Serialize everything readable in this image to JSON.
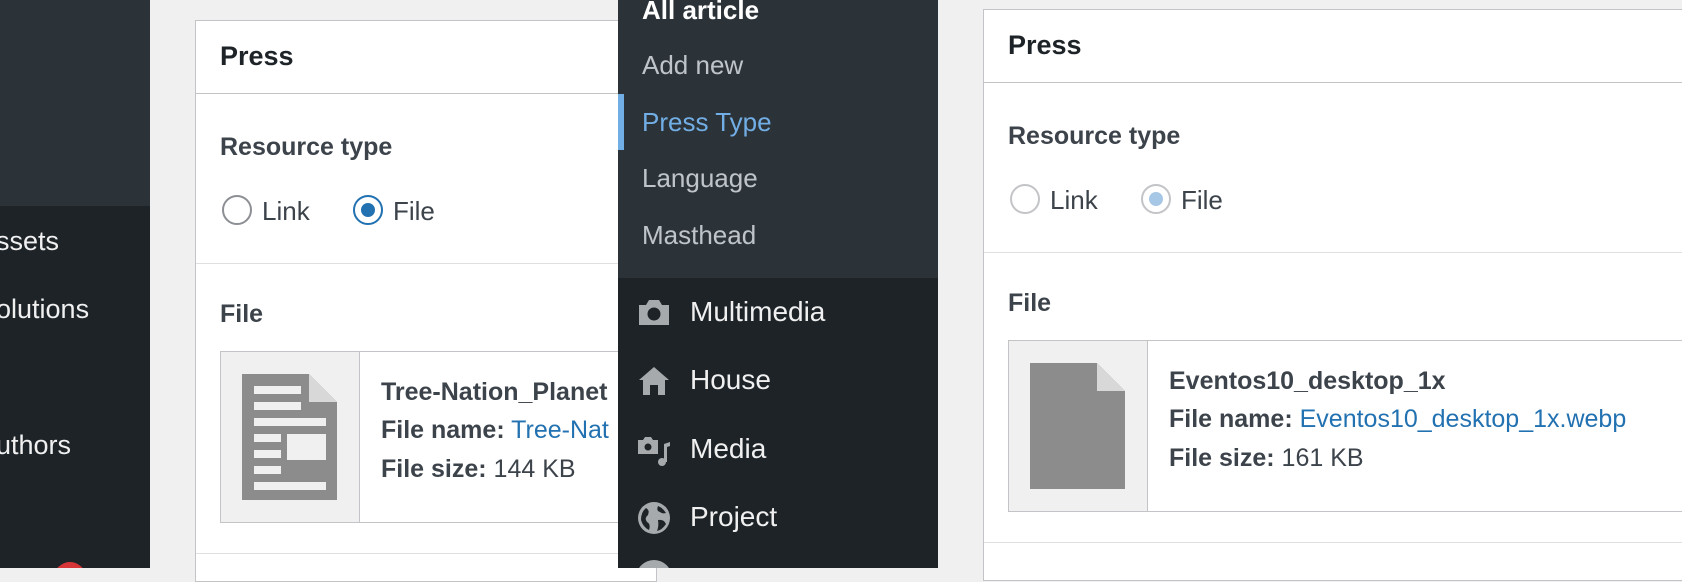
{
  "left_sidebar": {
    "items": [
      {
        "label": "ssets"
      },
      {
        "label": "olutions"
      },
      {
        "label": "uthors"
      }
    ]
  },
  "left_panel": {
    "title": "Press",
    "resource_type_label": "Resource type",
    "radio_link_label": "Link",
    "radio_file_label": "File",
    "selected": "File",
    "file_section_label": "File",
    "file": {
      "title": "Tree-Nation_Planet",
      "name_label": "File name:",
      "name_value": "Tree-Nat",
      "size_label": "File size:",
      "size_value": "144 KB"
    }
  },
  "admin_menu": {
    "submenu": [
      {
        "label": "All article"
      },
      {
        "label": "Add new"
      },
      {
        "label": "Press Type"
      },
      {
        "label": "Language"
      },
      {
        "label": "Masthead"
      }
    ],
    "current_submenu": "Press Type",
    "items": [
      {
        "label": "Multimedia",
        "icon": "camera-icon"
      },
      {
        "label": "House",
        "icon": "house-icon"
      },
      {
        "label": "Media",
        "icon": "media-icon"
      },
      {
        "label": "Project",
        "icon": "globe-icon"
      }
    ]
  },
  "right_panel": {
    "title": "Press",
    "resource_type_label": "Resource type",
    "radio_link_label": "Link",
    "radio_file_label": "File",
    "selected": "File",
    "file_section_label": "File",
    "file": {
      "title": "Eventos10_desktop_1x",
      "name_label": "File name:",
      "name_value": "Eventos10_desktop_1x.webp",
      "size_label": "File size:",
      "size_value": "161 KB"
    }
  },
  "colors": {
    "link": "#2271b1",
    "menu_highlight": "#72aee6",
    "radio_checked": "#2271b1",
    "radio_checked_disabled": "#a7c7e7"
  }
}
